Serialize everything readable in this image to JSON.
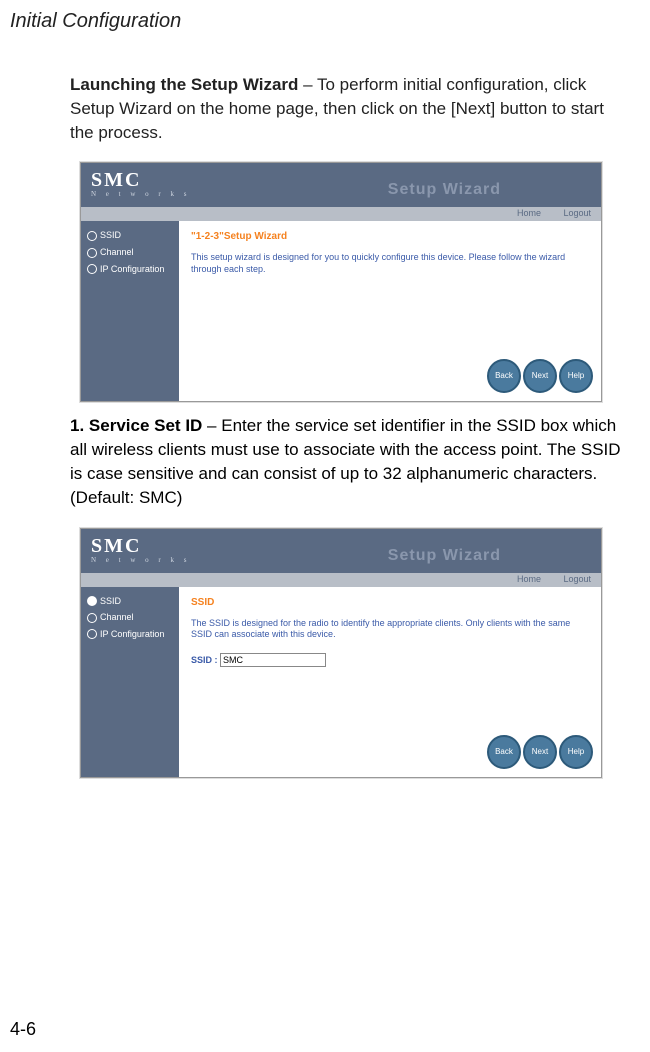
{
  "pageHeader": "Initial Configuration",
  "pageNumber": "4-6",
  "launchingBold": "Launching the Setup Wizard",
  "launchingText": " – To perform initial configuration, click Setup Wizard on the home page, then click on the [Next] button to start the process.",
  "step1Num": "1.",
  "step1Bold": "Service Set ID",
  "step1Text": " – Enter the service set identifier in the SSID box which all wireless clients must use to associate with the access point. The SSID is case sensitive and can consist of up to 32 alphanumeric characters.",
  "step1Default": "(Default: SMC)",
  "ss": {
    "logoBig": "SMC",
    "logoSmall": "N e t w o r k s",
    "wizardTitle": "Setup Wizard",
    "home": "Home",
    "logout": "Logout",
    "sidebarSSID": "SSID",
    "sidebarChannel": "Channel",
    "sidebarIP": "IP Configuration",
    "shot1Title": "\"1-2-3\"Setup Wizard",
    "shot1Text": "This setup wizard is designed for you to quickly configure this device. Please follow the wizard through each step.",
    "shot2Title": "SSID",
    "shot2Text": "The SSID is designed for the radio to identify the appropriate clients. Only clients with the same SSID can associate with this device.",
    "ssidLabel": "SSID :",
    "ssidValue": "SMC",
    "btnBack": "Back",
    "btnNext": "Next",
    "btnHelp": "Help"
  }
}
